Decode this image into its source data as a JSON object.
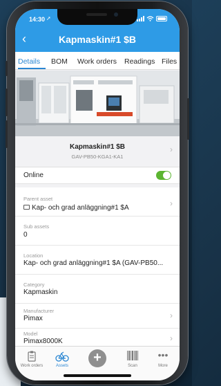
{
  "status": {
    "time": "14:30"
  },
  "header": {
    "title": "Kapmaskin#1 $B",
    "back_icon": "chevron-left-icon"
  },
  "tabs": [
    "Details",
    "BOM",
    "Work orders",
    "Readings",
    "Files"
  ],
  "active_tab": "Details",
  "asset": {
    "name": "Kapmaskin#1 $B",
    "code": "GAV-PB50-KGA1-KA1"
  },
  "online": {
    "label": "Online",
    "value": true
  },
  "fields": [
    {
      "label": "Parent asset",
      "value": "Kap- och grad anläggning#1 $A",
      "icon": "folder-icon"
    },
    {
      "label": "Sub assets",
      "value": "0"
    },
    {
      "label": "Location",
      "value": "Kap- och grad anläggning#1 $A (GAV-PB50..."
    },
    {
      "label": "Category",
      "value": "Kapmaskin"
    },
    {
      "label": "Manufacturer",
      "value": "Pimax"
    },
    {
      "label": "Model",
      "value": "Pimax8000K"
    }
  ],
  "bottom_nav": [
    {
      "label": "Work orders",
      "icon": "clipboard-icon"
    },
    {
      "label": "Assets",
      "icon": "bicycle-icon",
      "active": true
    },
    {
      "label": "",
      "icon": "plus-icon"
    },
    {
      "label": "Scan",
      "icon": "barcode-icon"
    },
    {
      "label": "More",
      "icon": "ellipsis-icon"
    }
  ],
  "colors": {
    "accent": "#2e9be6",
    "active": "#2a86d2",
    "toggle": "#5cb531"
  }
}
